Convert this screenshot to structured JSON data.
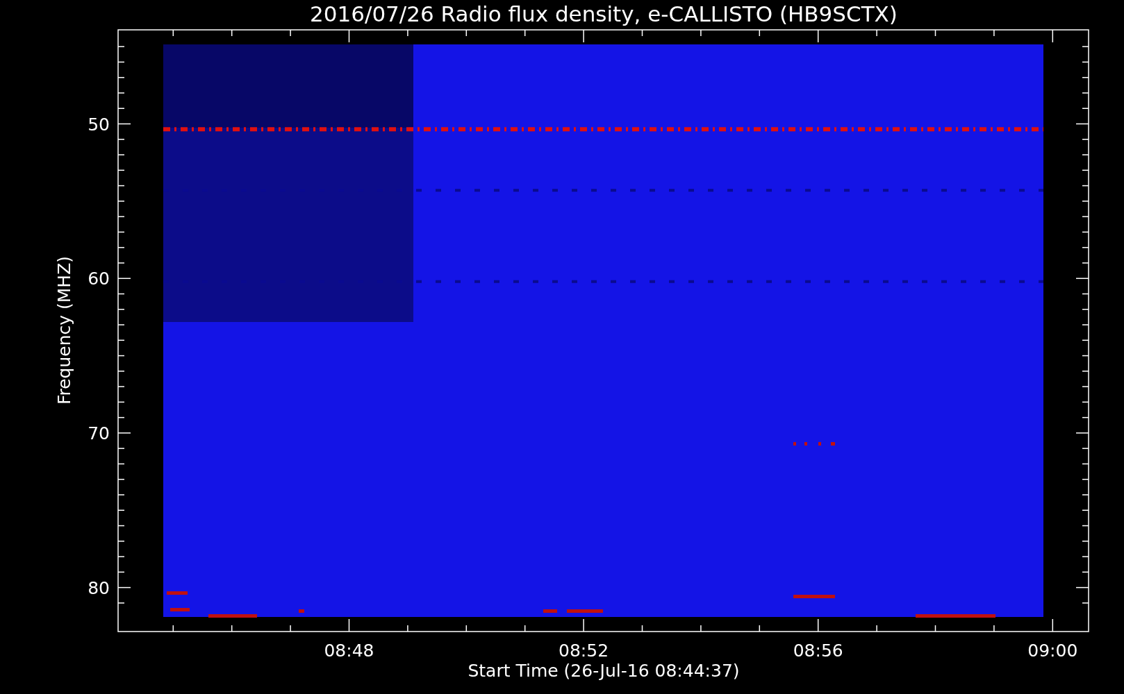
{
  "title": "2016/07/26  Radio flux density, e-CALLISTO (HB9SCTX)",
  "plot": {
    "xlabel": "Start Time (26-Jul-16 08:44:37)",
    "ylabel": "Frequency (MHZ)",
    "xticks": [
      "08:48",
      "08:52",
      "08:56",
      "09:00"
    ],
    "yticks": [
      "50",
      "60",
      "70",
      "80"
    ]
  }
}
